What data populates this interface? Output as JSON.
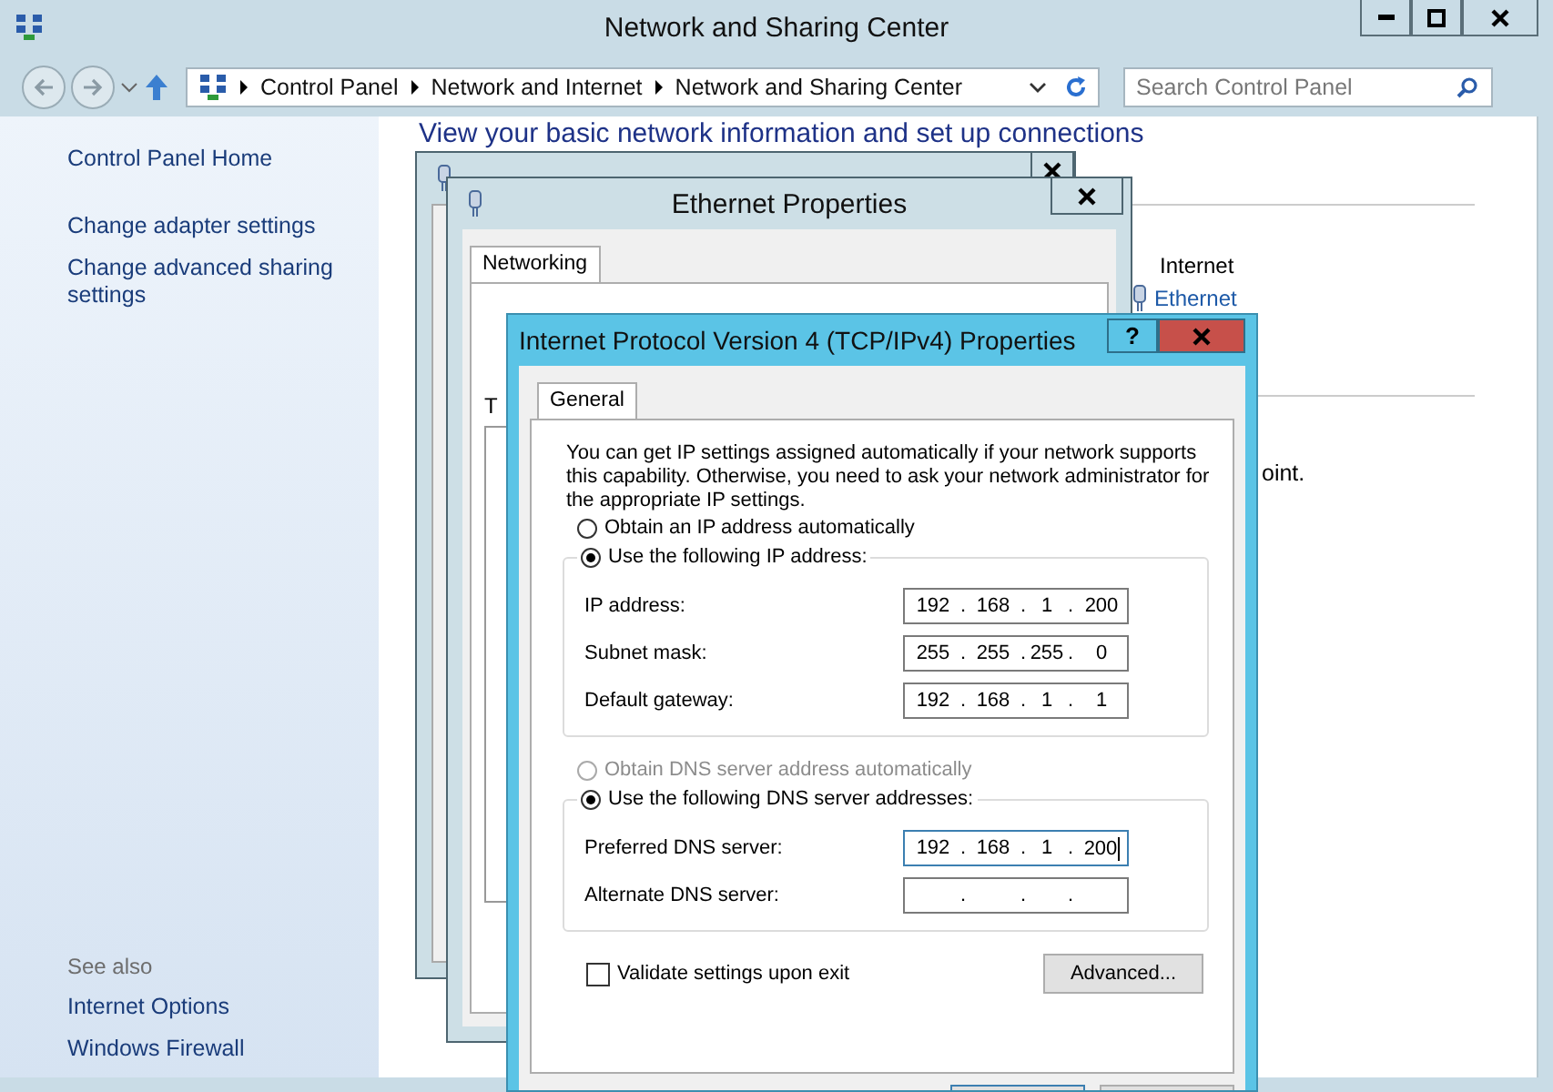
{
  "window": {
    "title": "Network and Sharing Center"
  },
  "address_bar": {
    "crumbs": [
      "Control Panel",
      "Network and Internet",
      "Network and Sharing Center"
    ]
  },
  "search": {
    "placeholder": "Search Control Panel"
  },
  "sidebar": {
    "links": [
      "Control Panel Home",
      "Change adapter settings",
      "Change advanced sharing settings"
    ],
    "see_also_title": "See also",
    "see_also": [
      "Internet Options",
      "Windows Firewall"
    ]
  },
  "content": {
    "heading": "View your basic network information and set up connections",
    "network_label": "Internet",
    "connection_link": "Ethernet",
    "fragment": "oint."
  },
  "ethernet_properties": {
    "title": "Ethernet Properties",
    "tabs": [
      {
        "label": "Networking",
        "selected": true
      }
    ],
    "fragment": "T"
  },
  "ipv4_dialog": {
    "title": "Internet Protocol Version 4 (TCP/IPv4) Properties",
    "help": "?",
    "tabs": [
      {
        "label": "General",
        "selected": true
      }
    ],
    "intro": "You can get IP settings assigned automatically if your network supports this capability. Otherwise, you need to ask your network administrator for the appropriate IP settings.",
    "ip_mode": [
      {
        "label": "Obtain an IP address automatically",
        "selected": false,
        "disabled": false
      },
      {
        "label": "Use the following IP address:",
        "selected": true,
        "disabled": false
      }
    ],
    "ip_fields": [
      {
        "label": "IP address:",
        "octets": [
          "192",
          "168",
          "1",
          "200"
        ],
        "dots": [
          ".",
          ".",
          "."
        ],
        "focused": false
      },
      {
        "label": "Subnet mask:",
        "octets": [
          "255",
          "255",
          "255",
          "0"
        ],
        "dots": [
          ".",
          ".",
          "."
        ],
        "focused": false
      },
      {
        "label": "Default gateway:",
        "octets": [
          "192",
          "168",
          "1",
          "1"
        ],
        "dots": [
          ".",
          ".",
          "."
        ],
        "focused": false
      }
    ],
    "dns_mode": [
      {
        "label": "Obtain DNS server address automatically",
        "selected": false,
        "disabled": true
      },
      {
        "label": "Use the following DNS server addresses:",
        "selected": true,
        "disabled": false
      }
    ],
    "dns_fields": [
      {
        "label": "Preferred DNS server:",
        "octets": [
          "192",
          "168",
          "1",
          "200"
        ],
        "dots": [
          ".",
          ".",
          "."
        ],
        "focused": true
      },
      {
        "label": "Alternate DNS server:",
        "dots": [
          ".",
          ".",
          "."
        ],
        "focused": false
      }
    ],
    "validate": {
      "label": "Validate settings upon exit",
      "checked": false
    },
    "advanced_button": "Advanced..."
  }
}
